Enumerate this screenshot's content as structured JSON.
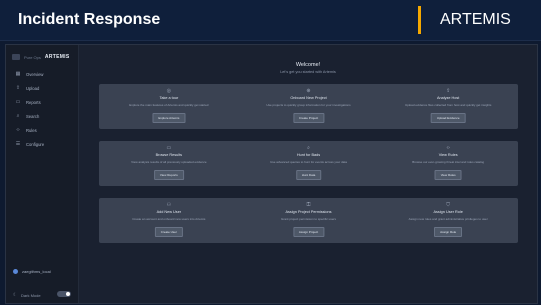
{
  "slide": {
    "title": "Incident Response",
    "brand": "ARTEMIS",
    "accent_color": "#f5a800",
    "background_color": "#0e1a30"
  },
  "app": {
    "logo": {
      "prefix": "Pure Ops",
      "name": "ARTEMIS"
    },
    "nav": [
      {
        "label": "Overview",
        "icon": "grid-icon"
      },
      {
        "label": "Upload",
        "icon": "upload-icon"
      },
      {
        "label": "Reports",
        "icon": "folder-icon"
      },
      {
        "label": "Search",
        "icon": "search-icon"
      },
      {
        "label": "Rules",
        "icon": "code-icon"
      },
      {
        "label": "Configure",
        "icon": "settings-icon"
      }
    ],
    "user": {
      "name": "zaegithms_local"
    },
    "mode": {
      "label": "Dark Mode",
      "enabled": true
    },
    "welcome": {
      "title": "Welcome!",
      "subtitle": "Let's get you started with Artemis"
    },
    "sections": [
      {
        "cards": [
          {
            "icon": "compass-icon",
            "title": "Take a tour",
            "desc": "Explore the main features of Artemis and quickly get started",
            "button": "Explore Artemis"
          },
          {
            "icon": "plus-icon",
            "title": "Onboard New Project",
            "desc": "Use projects to quickly group information for your investigations",
            "button": "Create Project"
          },
          {
            "icon": "upload-icon",
            "title": "Analyze Host",
            "desc": "Upload evidence files collected from host and quickly get insights",
            "button": "Upload Evidence"
          }
        ]
      },
      {
        "cards": [
          {
            "icon": "folder-icon",
            "title": "Browse Results",
            "desc": "View analysis results of all previously uploaded evidence",
            "button": "View Reports"
          },
          {
            "icon": "search-icon",
            "title": "Hunt for Bads",
            "desc": "Use advanced queries to hunt for events across your data",
            "button": "Hunt Data"
          },
          {
            "icon": "code-icon",
            "title": "View Rules",
            "desc": "Browse our ever-growing threat intel and rules catalog",
            "button": "View Rules"
          }
        ]
      },
      {
        "cards": [
          {
            "icon": "user-plus-icon",
            "title": "Add New User",
            "desc": "Create an account and onboard new users into Artemis",
            "button": "Create User"
          },
          {
            "icon": "key-icon",
            "title": "Assign Project Permissions",
            "desc": "Grant project permission to specific users",
            "button": "Assign Project"
          },
          {
            "icon": "shield-icon",
            "title": "Assign User Role",
            "desc": "Assign new roles and grant administrative privileges to user",
            "button": "Assign Role"
          }
        ]
      }
    ]
  }
}
